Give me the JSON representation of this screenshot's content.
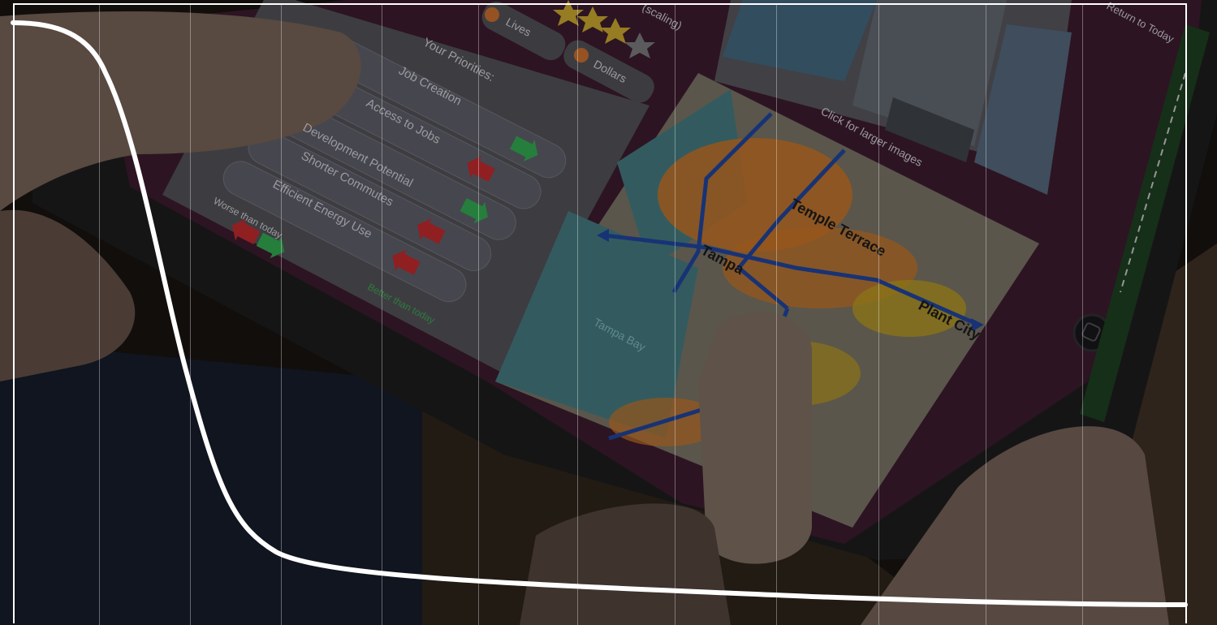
{
  "colors": {
    "background": "#14110f",
    "device_frame": "#1b1a1c",
    "app_panel": "#3a1a2a",
    "card": "#4a4a4f",
    "arrow_up": "#2f9a4a",
    "arrow_down": "#b0262a",
    "map_water": "#3f6f74",
    "map_land": "#6f6a5c",
    "heat_orange": "#b86a22",
    "heat_yellow": "#a98d1d",
    "route_blue": "#1e3f8f",
    "overlay_curve": "#ffffff"
  },
  "tablet": {
    "rating_text": "(scaling)",
    "tabs": [
      "Lives",
      "Dollars"
    ],
    "return_button": "Return to\nToday",
    "priorities_title": "Your Priorities:",
    "priorities": [
      {
        "label": "Job Creation",
        "direction": "up"
      },
      {
        "label": "Access to Jobs",
        "direction": "down"
      },
      {
        "label": "Development Potential",
        "direction": "up"
      },
      {
        "label": "Shorter Commutes",
        "direction": "down"
      },
      {
        "label": "Efficient Energy Use",
        "direction": "down"
      }
    ],
    "legend_worse": "Worse than today",
    "legend_better": "Better than today",
    "images_caption": "Click for larger images",
    "map_labels": [
      "Temple Terrace",
      "Tampa",
      "Plant City",
      "Tampa Bay"
    ]
  }
}
